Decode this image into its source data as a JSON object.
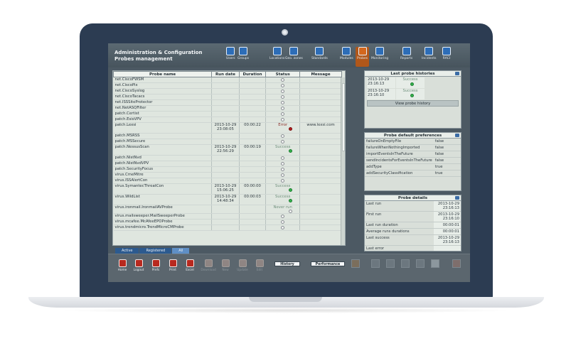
{
  "header": {
    "title_line1": "Administration & Configuration",
    "title_line2": "Probes management"
  },
  "nav": [
    {
      "label": "Users",
      "icon": "users-icon"
    },
    {
      "label": "Groups",
      "icon": "groups-icon"
    },
    {
      "label": "Locations",
      "icon": "locations-icon"
    },
    {
      "label": "Geo. zones",
      "icon": "geo-zones-icon"
    },
    {
      "label": "Standards",
      "icon": "standards-icon"
    },
    {
      "label": "Modules",
      "icon": "modules-icon"
    },
    {
      "label": "Probes",
      "icon": "probes-icon",
      "active": true
    },
    {
      "label": "Monitoring",
      "icon": "monitoring-icon"
    },
    {
      "label": "Reports",
      "icon": "reports-icon"
    },
    {
      "label": "Incidents",
      "icon": "incidents-icon"
    },
    {
      "label": "RACI",
      "icon": "raci-icon"
    }
  ],
  "grid": {
    "columns": [
      "Probe name",
      "Run date",
      "Duration",
      "Status",
      "Message"
    ],
    "rows": [
      {
        "name": "net.CiscoFWSM",
        "date": "",
        "duration": "",
        "status": "",
        "dot": "empty",
        "message": ""
      },
      {
        "name": "net.CiscoPix",
        "date": "",
        "duration": "",
        "status": "",
        "dot": "empty",
        "message": ""
      },
      {
        "name": "net.CiscoSyslog",
        "date": "",
        "duration": "",
        "status": "",
        "dot": "empty",
        "message": ""
      },
      {
        "name": "net.CiscoTacacs",
        "date": "",
        "duration": "",
        "status": "",
        "dot": "empty",
        "message": ""
      },
      {
        "name": "net.ISSSiteProtector",
        "date": "",
        "duration": "",
        "status": "",
        "dot": "empty",
        "message": ""
      },
      {
        "name": "net.NetASQFilter",
        "date": "",
        "duration": "",
        "status": "",
        "dot": "empty",
        "message": ""
      },
      {
        "name": "patch.Certist",
        "date": "",
        "duration": "",
        "status": "",
        "dot": "empty",
        "message": ""
      },
      {
        "name": "patch.EsisVPV",
        "date": "",
        "duration": "",
        "status": "",
        "dot": "empty",
        "message": ""
      },
      {
        "name": "patch.Lexsi",
        "date": "2013-10-29 23:08:05",
        "duration": "00:00:22",
        "status": "Error",
        "dot": "red",
        "message": "www.lexsi.com",
        "tall": true
      },
      {
        "name": "patch.MSRSS",
        "date": "",
        "duration": "",
        "status": "",
        "dot": "empty",
        "message": ""
      },
      {
        "name": "patch.MSSecure",
        "date": "",
        "duration": "",
        "status": "",
        "dot": "empty",
        "message": ""
      },
      {
        "name": "patch.NessusScan",
        "date": "2013-10-29 22:56:29",
        "duration": "00:00:19",
        "status": "Success",
        "dot": "green",
        "message": "",
        "tall": true
      },
      {
        "name": "patch.NistNvd",
        "date": "",
        "duration": "",
        "status": "",
        "dot": "empty",
        "message": ""
      },
      {
        "name": "patch.NistNvdVPV",
        "date": "",
        "duration": "",
        "status": "",
        "dot": "empty",
        "message": ""
      },
      {
        "name": "patch.SecurityFocus",
        "date": "",
        "duration": "",
        "status": "",
        "dot": "empty",
        "message": ""
      },
      {
        "name": "virus.CmeMitre",
        "date": "",
        "duration": "",
        "status": "",
        "dot": "empty",
        "message": ""
      },
      {
        "name": "virus.ISSAlertCon",
        "date": "",
        "duration": "",
        "status": "",
        "dot": "empty",
        "message": ""
      },
      {
        "name": "virus.SymantecThreatCon",
        "date": "2013-10-29 15:06:25",
        "duration": "00:00:00",
        "status": "Success",
        "dot": "green",
        "message": "",
        "tall": true
      },
      {
        "name": "virus.WildList",
        "date": "2013-10-29 14:48:34",
        "duration": "00:00:03",
        "status": "Success",
        "dot": "green",
        "message": "",
        "tall": true
      },
      {
        "name": "virus.ironmail.IronmailAVProbe",
        "date": "",
        "duration": "",
        "status": "Never run",
        "dot": "empty",
        "message": ""
      },
      {
        "name": "virus.mailsweeper.MailSweeperProbe",
        "date": "",
        "duration": "",
        "status": "",
        "dot": "empty",
        "message": ""
      },
      {
        "name": "virus.mcafee.McAfeeEPOProbe",
        "date": "",
        "duration": "",
        "status": "",
        "dot": "empty",
        "message": ""
      },
      {
        "name": "virus.trendmicro.TrendMicroCMProbe",
        "date": "",
        "duration": "",
        "status": "",
        "dot": "empty",
        "message": ""
      }
    ]
  },
  "tabs": [
    "Active",
    "Registered",
    "All"
  ],
  "last_histories": {
    "title": "Last probe histories",
    "rows": [
      {
        "date": "2013-10-29 23:16:13",
        "status": "Success"
      },
      {
        "date": "2013-10-29 23:16:10",
        "status": "Success"
      }
    ],
    "button": "View probe history"
  },
  "preferences": {
    "title": "Probe default preferences",
    "rows": [
      {
        "key": "failureOnEmptyFile",
        "value": "false"
      },
      {
        "key": "failureWhenNothingImported",
        "value": "false"
      },
      {
        "key": "importEventsInTheFuture",
        "value": "false"
      },
      {
        "key": "sendIncidentsForEventsInTheFuture",
        "value": "false"
      },
      {
        "key": "addType",
        "value": "true"
      },
      {
        "key": "addSecurityClassification",
        "value": "true"
      }
    ]
  },
  "details": {
    "title": "Probe details",
    "rows": [
      {
        "key": "Last run",
        "value": "2013-10-29 23:16:13"
      },
      {
        "key": "First run",
        "value": "2013-10-29 23:16:10"
      },
      {
        "key": "Last run duration",
        "value": "00:00:01"
      },
      {
        "key": "Average runs durations",
        "value": "00:00:01"
      },
      {
        "key": "Last success",
        "value": "2013-10-29 23:16:13"
      },
      {
        "key": "Last error",
        "value": ""
      }
    ]
  },
  "footer": {
    "buttons": [
      {
        "label": "Home",
        "enabled": true
      },
      {
        "label": "Logout",
        "enabled": true
      },
      {
        "label": "Prefs",
        "enabled": true
      },
      {
        "label": "Print",
        "enabled": true
      },
      {
        "label": "Excel",
        "enabled": true
      },
      {
        "label": "Download",
        "enabled": false
      },
      {
        "label": "New",
        "enabled": false
      },
      {
        "label": "Update",
        "enabled": false
      },
      {
        "label": "Edit",
        "enabled": false
      }
    ],
    "history_label": "History",
    "performance_label": "Performance"
  }
}
